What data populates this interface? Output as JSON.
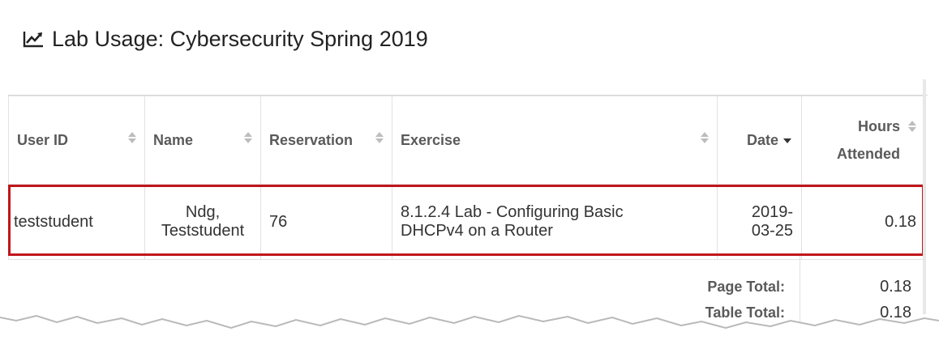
{
  "title": "Lab Usage: Cybersecurity Spring 2019",
  "title_icon": "line-chart-icon",
  "columns": {
    "user_id": "User ID",
    "name": "Name",
    "reservation": "Reservation",
    "exercise": "Exercise",
    "date": "Date",
    "hours": "Hours Attended"
  },
  "sort": {
    "column": "date",
    "direction": "descending"
  },
  "rows": [
    {
      "user_id": "teststudent",
      "name_line1": "Ndg,",
      "name_line2": "Teststudent",
      "reservation": "76",
      "exercise_line1": "8.1.2.4 Lab - Configuring Basic",
      "exercise_line2": "DHCPv4 on a Router",
      "date_line1": "2019-",
      "date_line2": "03-25",
      "hours": "0.18"
    }
  ],
  "totals": {
    "page_label": "Page Total:",
    "page_value": "0.18",
    "table_label": "Table Total:",
    "table_value": "0.18"
  },
  "colors": {
    "highlight": "#c0161b",
    "header_text": "#5a5a5a"
  }
}
